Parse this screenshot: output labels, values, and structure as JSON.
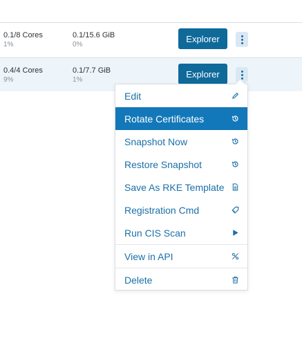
{
  "rows": [
    {
      "cpu": "0.1/8 Cores",
      "cpu_pct": "1%",
      "memory": "0.1/15.6 GiB",
      "memory_pct": "0%",
      "explorer_label": "Explorer"
    },
    {
      "cpu": "0.4/4 Cores",
      "cpu_pct": "9%",
      "memory": "0.1/7.7 GiB",
      "memory_pct": "1%",
      "explorer_label": "Explorer"
    }
  ],
  "actions_menu": {
    "items": [
      {
        "label": "Edit",
        "icon": "pencil-icon"
      },
      {
        "label": "Rotate Certificates",
        "icon": "history-icon",
        "active": true
      },
      {
        "label": "Snapshot Now",
        "icon": "history-icon"
      },
      {
        "label": "Restore Snapshot",
        "icon": "history-icon"
      },
      {
        "label": "Save As RKE Template",
        "icon": "file-icon"
      },
      {
        "label": "Registration Cmd",
        "icon": "tag-icon"
      },
      {
        "label": "Run CIS Scan",
        "icon": "play-icon"
      },
      {
        "label": "View in API",
        "icon": "api-icon"
      },
      {
        "label": "Delete",
        "icon": "trash-icon"
      }
    ]
  },
  "colors": {
    "accent": "#0f6a9a",
    "menu_text": "#1a6fa8",
    "menu_active_bg": "#1378b9",
    "selected_row_bg": "#edf5fa"
  }
}
